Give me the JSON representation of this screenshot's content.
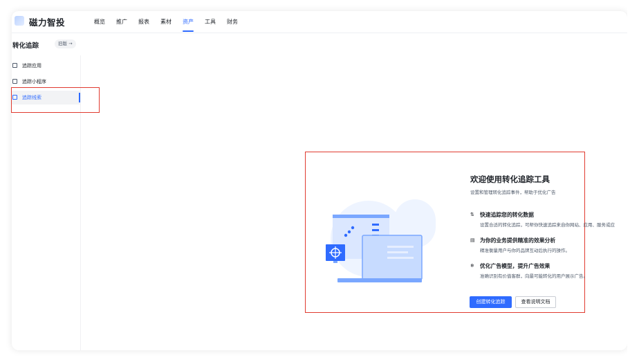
{
  "brand": {
    "name": "磁力智投"
  },
  "nav": {
    "items": [
      {
        "label": "概览",
        "active": false
      },
      {
        "label": "推广",
        "active": false
      },
      {
        "label": "报表",
        "active": false
      },
      {
        "label": "素材",
        "active": false
      },
      {
        "label": "资产",
        "active": true
      },
      {
        "label": "工具",
        "active": false
      },
      {
        "label": "财务",
        "active": false
      }
    ]
  },
  "page": {
    "title": "转化追踪",
    "old_version_label": "旧版 →"
  },
  "sidebar": {
    "items": [
      {
        "label": "追踪应用",
        "icon": "image-icon",
        "active": false
      },
      {
        "label": "追踪小程序",
        "icon": "mini-program-icon",
        "active": false
      },
      {
        "label": "追踪线索",
        "icon": "lead-icon",
        "active": true
      }
    ]
  },
  "welcome": {
    "title": "欢迎使用转化追踪工具",
    "subtitle": "设置和管理转化追踪事件，帮助于优化广告",
    "features": [
      {
        "icon_glyph": "⇅",
        "icon": "data-track-icon",
        "title": "快速追踪您的转化数据",
        "desc": "设置合适的转化追踪，可帮你快速追踪来自你网站、应用、服务或应"
      },
      {
        "icon_glyph": "▤",
        "icon": "analysis-icon",
        "title": "为你的业务提供精准的效果分析",
        "desc": "精准衡量用户与你的品牌互动后执行的操作。"
      },
      {
        "icon_glyph": "❄",
        "icon": "optimize-icon",
        "title": "优化广告模型，提升广告效果",
        "desc": "准确识别有价值客群，向最可能转化的用户展示广告。"
      }
    ],
    "primary_button": "创建转化追踪",
    "secondary_button": "查看说明文档"
  },
  "colors": {
    "accent": "#2f6bff",
    "highlight_box": "#e03a2f",
    "text": "#1f2329",
    "muted": "#4e5969"
  }
}
